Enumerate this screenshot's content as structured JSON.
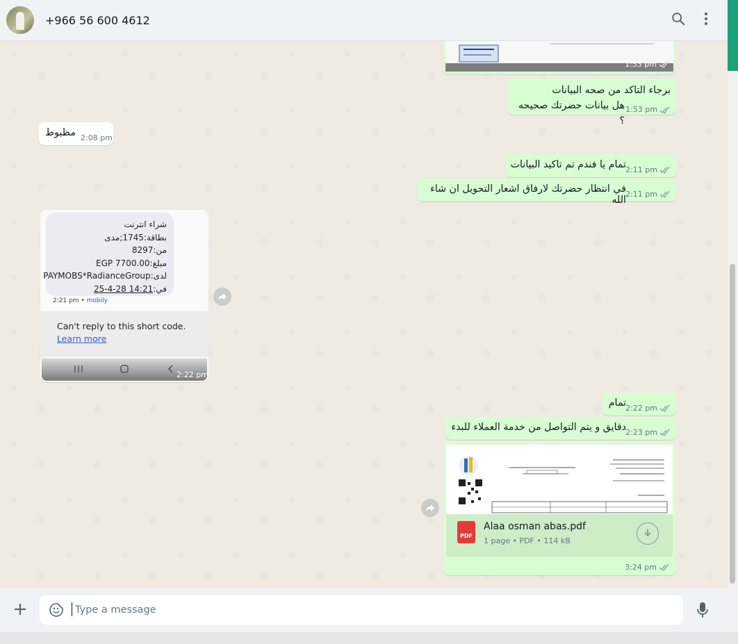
{
  "header": {
    "contact_name": "+966 56 600 4612",
    "search_icon": "search-icon",
    "menu_icon": "kebab-menu-icon"
  },
  "messages": {
    "m1_time": "1:53 pm",
    "m2_line1": "برجاء التاكد من صحه البيانات",
    "m2_line2": "هل بيانات حضرتك صحيحه ؟",
    "m2_time": "1:53 pm",
    "m3_text": "مظبوط",
    "m3_time": "2:08 pm",
    "m4_text": "تمام يا فندم تم تاكيد البيانات",
    "m4_time": "2:11 pm",
    "m5_text": "في انتظار حضرتك لارفاق اشعار التحويل ان شاء الله",
    "m5_time": "2:11 pm",
    "m6_time": "2:22 pm",
    "m7_text": "تمام",
    "m7_time": "2:22 pm",
    "m8_text": "دقايق و يتم التواصل من خدمة العملاء للبدء",
    "m8_time": "2:23 pm",
    "m9_time": "3:24 pm"
  },
  "sms": {
    "line1": "شراء انترنت",
    "line2": "بطاقة:1745;مدى",
    "line3": "من:8297",
    "line4": "مبلغ:EGP 7700.00",
    "line5": "لدى:PAYMOBS*RadianceGroup",
    "line6_prefix": "في:",
    "line6_date": "25-4-28 14:21",
    "time": "2:21 pm",
    "sep": "•",
    "carrier": "mobily",
    "note": "Can't reply to this short code.",
    "learn_more": "Learn more"
  },
  "doc": {
    "filename": "Alaa osman abas.pdf",
    "info": "1 page • PDF • 114 kB",
    "pdf_label": "PDF"
  },
  "composer": {
    "placeholder": "Type a message"
  },
  "colors": {
    "outgoing": "#d9fdd3",
    "incoming": "#ffffff",
    "header": "#f0f2f5",
    "accent": "#1aa179"
  }
}
